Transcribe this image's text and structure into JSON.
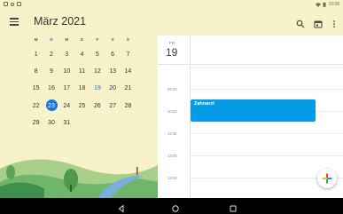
{
  "status_bar": {
    "time": "15:08"
  },
  "app_bar": {
    "month_title": "März 2021",
    "icons": [
      "menu-icon",
      "search-icon",
      "calendar-today-icon",
      "more-vert-icon"
    ]
  },
  "mini_month": {
    "weekdays": [
      "M",
      "D",
      "M",
      "D",
      "F",
      "S",
      "S"
    ],
    "weeks": [
      [
        "1",
        "2",
        "3",
        "4",
        "5",
        "6",
        "7"
      ],
      [
        "8",
        "9",
        "10",
        "11",
        "12",
        "13",
        "14"
      ],
      [
        "15",
        "16",
        "17",
        "18",
        "19",
        "20",
        "21"
      ],
      [
        "22",
        "23",
        "24",
        "25",
        "26",
        "27",
        "28"
      ],
      [
        "29",
        "30",
        "31",
        "",
        "",
        "",
        ""
      ]
    ],
    "today": "23",
    "selected": "19"
  },
  "day_view": {
    "weekday": "FR",
    "day_number": "19",
    "hours": [
      "09:00",
      "10:00",
      "11:00",
      "12:00",
      "13:00"
    ],
    "event": {
      "title": "Zahnarzt"
    }
  },
  "colors": {
    "accent": "#1a73e8",
    "event": "#039be5",
    "background": "#f7f2c9"
  }
}
